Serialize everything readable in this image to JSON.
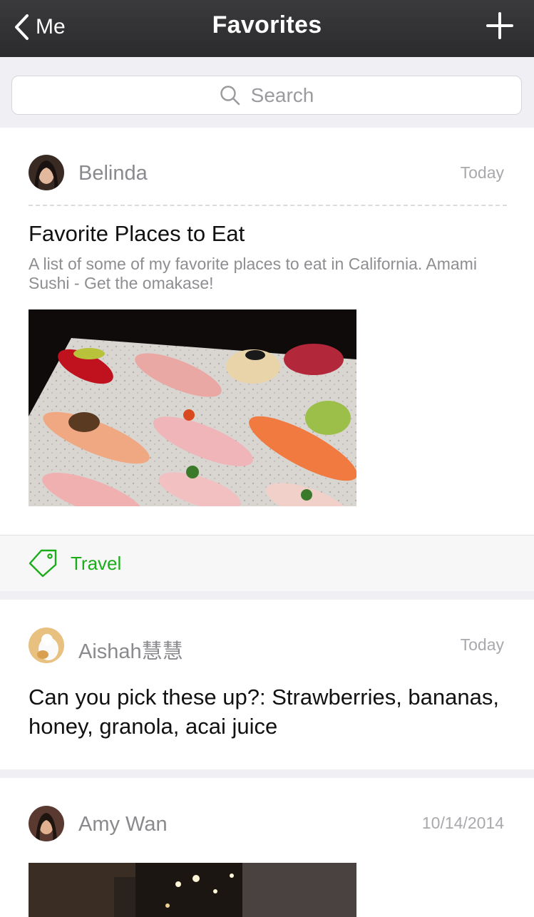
{
  "nav": {
    "back_label": "Me",
    "title": "Favorites",
    "add_icon": "plus-icon"
  },
  "search": {
    "placeholder": "Search"
  },
  "items": [
    {
      "author": "Belinda",
      "date": "Today",
      "title": "Favorite Places to Eat",
      "description": "A list of some of my favorite places to eat in California. Amami Sushi - Get the omakase!",
      "tag": "Travel"
    },
    {
      "author": "Aishah慧慧",
      "date": "Today",
      "text": "Can you pick these up?: Strawberries, bananas, honey, granola, acai juice"
    },
    {
      "author": "Amy Wan",
      "date": "10/14/2014"
    }
  ],
  "colors": {
    "accent": "#1aad19",
    "navbar": "#2f2f31"
  }
}
